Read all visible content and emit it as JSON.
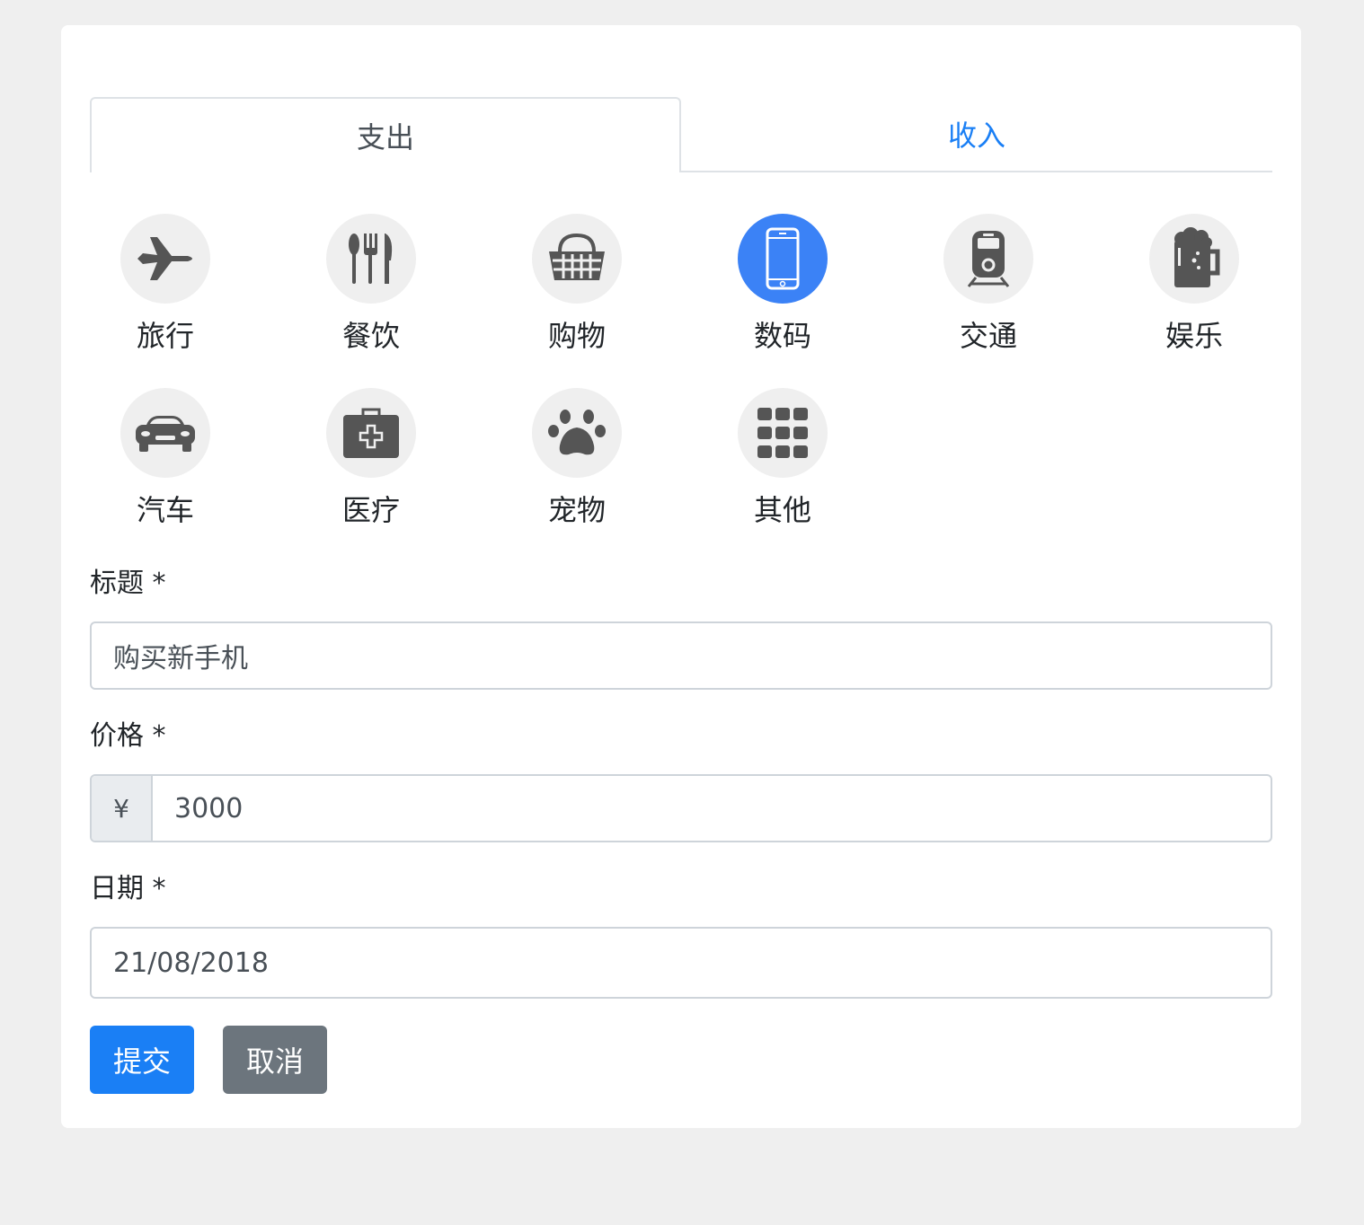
{
  "tabs": [
    {
      "label": "支出",
      "active": true
    },
    {
      "label": "收入",
      "active": false
    }
  ],
  "categories": [
    {
      "label": "旅行",
      "icon": "plane-icon"
    },
    {
      "label": "餐饮",
      "icon": "cutlery-icon"
    },
    {
      "label": "购物",
      "icon": "basket-icon"
    },
    {
      "label": "数码",
      "icon": "phone-icon",
      "selected": true
    },
    {
      "label": "交通",
      "icon": "train-icon"
    },
    {
      "label": "娱乐",
      "icon": "beer-icon"
    },
    {
      "label": "汽车",
      "icon": "car-icon"
    },
    {
      "label": "医疗",
      "icon": "medkit-icon"
    },
    {
      "label": "宠物",
      "icon": "paw-icon"
    },
    {
      "label": "其他",
      "icon": "grid-icon"
    }
  ],
  "form": {
    "title_label": "标题 *",
    "title_value": "购买新手机",
    "price_label": "价格 *",
    "price_prefix": "¥",
    "price_value": "3000",
    "date_label": "日期 *",
    "date_value": "21/08/2018"
  },
  "buttons": {
    "submit": "提交",
    "cancel": "取消"
  },
  "colors": {
    "accent": "#1a7ff5",
    "selected_icon_bg": "#3b82f6",
    "icon_bg": "#efefef",
    "icon_fg": "#555555",
    "secondary": "#6c757d"
  }
}
